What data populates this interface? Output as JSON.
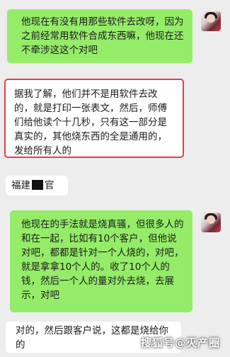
{
  "messages": [
    {
      "side": "right",
      "text": "他现在有没有用那些软件去改呀，因为之前经常用软件合成东西嘛，他现在还不牵涉这这个对吧"
    },
    {
      "side": "left",
      "text": "据我了解，他们并不是用软件去改的，就是打印一张表文，然后，师傅们给他读个十几秒，只有这一部分是真实的，其他烧东西的全是通用的，发给所有人的"
    },
    {
      "side": "left",
      "text_before": "福建",
      "text_after": "官"
    },
    {
      "side": "right",
      "text": "他现在的手法就是烧真骚，但很多人的和在一起，比如有10个客户，但他说对吧，都都是针对一个人烧的，对吧，就是拿拿10个人的。收了10个人的钱，然后一个人的量对外去烧，去展示，对吧"
    },
    {
      "side": "left",
      "text": "对的，然后跟客户说，这都是烧给你的"
    }
  ],
  "watermark": "搜狐号@灭产圈"
}
